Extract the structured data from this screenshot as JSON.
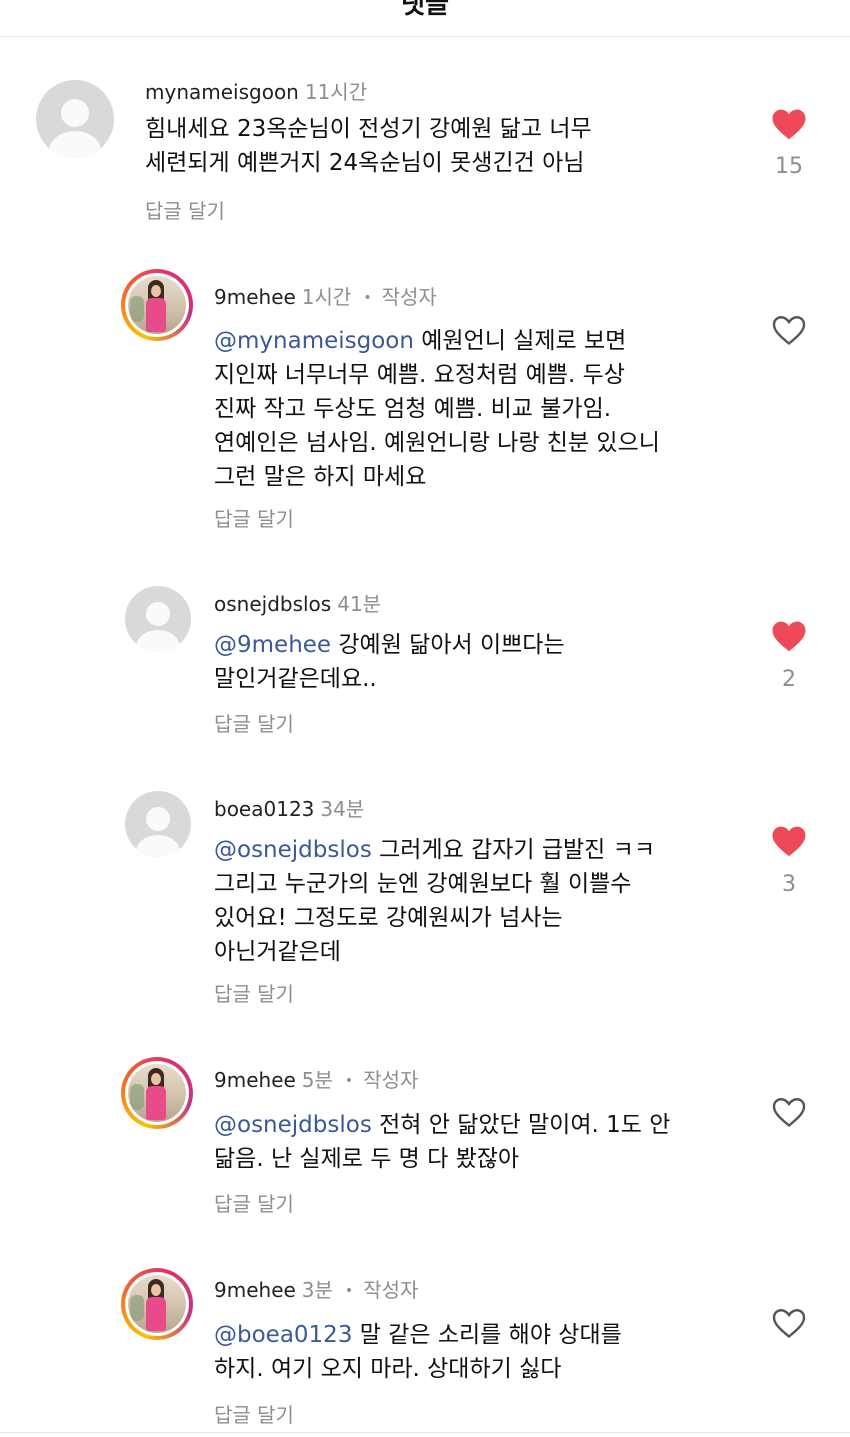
{
  "header": {
    "title": "댓글"
  },
  "colors": {
    "heart_liked": "#ed4956",
    "heart_outline": "#555555",
    "mention": "#3b5998",
    "meta_gray": "#8e8e8e"
  },
  "comments": [
    {
      "username": "mynameisgoon",
      "time": "11시간",
      "is_author": false,
      "mention": "",
      "text": "힘내세요 23옥순님이 전성기 강예원 닮고 너무\n세련되게 예쁜거지 24옥순님이 못생긴건 아님",
      "reply": "답글 달기",
      "liked": true,
      "likes": "15",
      "avatar": "default-avatar-icon"
    },
    {
      "username": "9mehee",
      "time": "1시간",
      "is_author": true,
      "author_label": "작성자",
      "mention": "@mynameisgoon",
      "text": " 예원언니 실제로 보면\n지인짜 너무너무 예쁨. 요정처럼 예쁨. 두상\n진짜 작고 두상도 엄청 예쁨. 비교 불가임.\n연예인은 넘사임. 예원언니랑 나랑 친분 있으니\n그런 말은 하지 마세요",
      "reply": "답글 달기",
      "liked": false,
      "likes": "",
      "avatar": "story-avatar"
    },
    {
      "username": "osnejdbslos",
      "time": "41분",
      "is_author": false,
      "mention": "@9mehee",
      "text": " 강예원 닮아서 이쁘다는\n말인거같은데요..",
      "reply": "답글 달기",
      "liked": true,
      "likes": "2",
      "avatar": "default-avatar-icon"
    },
    {
      "username": "boea0123",
      "time": "34분",
      "is_author": false,
      "mention": "@osnejdbslos",
      "text": " 그러게요 갑자기 급발진 ㅋㅋ\n그리고 누군가의 눈엔 강예원보다 훨 이쁠수\n있어요! 그정도로 강예원씨가 넘사는\n아닌거같은데",
      "reply": "답글 달기",
      "liked": true,
      "likes": "3",
      "avatar": "default-avatar-icon"
    },
    {
      "username": "9mehee",
      "time": "5분",
      "is_author": true,
      "author_label": "작성자",
      "mention": "@osnejdbslos",
      "text": " 전혀 안 닮았단 말이여. 1도 안\n닮음. 난 실제로 두 명 다 봤잖아",
      "reply": "답글 달기",
      "liked": false,
      "likes": "",
      "avatar": "story-avatar"
    },
    {
      "username": "9mehee",
      "time": "3분",
      "is_author": true,
      "author_label": "작성자",
      "mention": "@boea0123",
      "text": " 말 같은 소리를 해야 상대를\n하지. 여기 오지 마라. 상대하기 싫다",
      "reply": "답글 달기",
      "liked": false,
      "likes": "",
      "avatar": "story-avatar"
    }
  ]
}
